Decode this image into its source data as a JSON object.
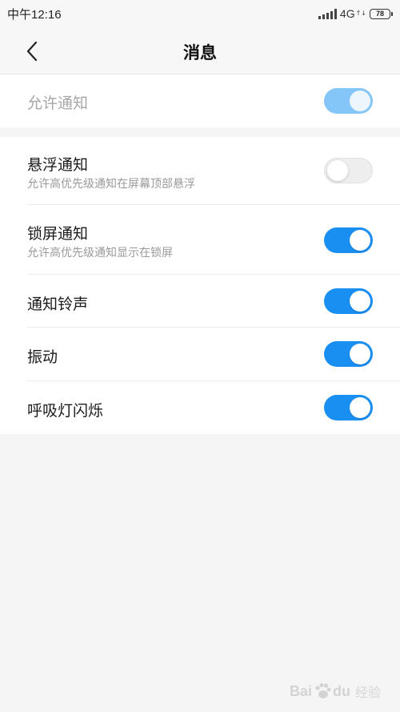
{
  "status_bar": {
    "time": "中午12:16",
    "network": "4G",
    "network_sub": "↑↓",
    "battery": "78"
  },
  "header": {
    "title": "消息"
  },
  "master_setting": {
    "label": "允许通知",
    "enabled": true,
    "state": "on-disabled-style"
  },
  "settings": [
    {
      "title": "悬浮通知",
      "subtitle": "允许高优先级通知在屏幕顶部悬浮",
      "on": false
    },
    {
      "title": "锁屏通知",
      "subtitle": "允许高优先级通知显示在锁屏",
      "on": true
    },
    {
      "title": "通知铃声",
      "on": true
    },
    {
      "title": "振动",
      "on": true
    },
    {
      "title": "呼吸灯闪烁",
      "on": true
    }
  ],
  "watermark": {
    "brand": "Bai",
    "brand_end": "du",
    "sub": "经验"
  },
  "colors": {
    "accent": "#1a8ff2",
    "accent_disabled": "#84c6f7",
    "background": "#f5f5f5"
  },
  "icons": {
    "back": "chevron-left-icon",
    "signal": "signal-icon",
    "battery": "battery-icon",
    "watermark": "baidu-paw-icon"
  }
}
